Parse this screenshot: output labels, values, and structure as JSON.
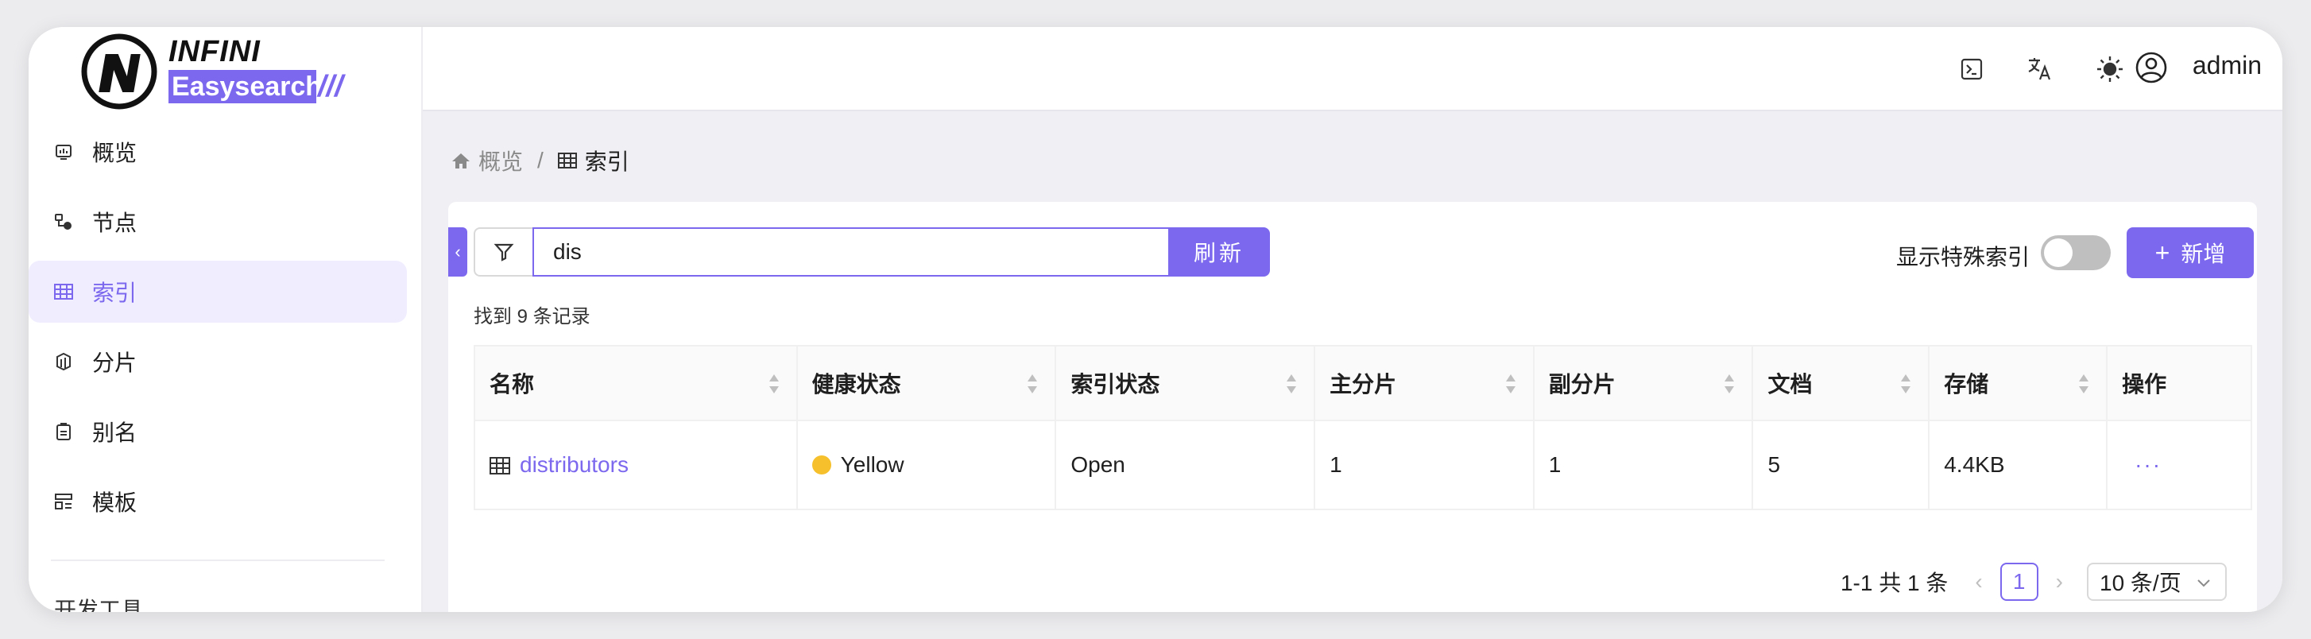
{
  "logo": {
    "top": "INFINI",
    "bottom": "Easysearch",
    "slashes": "///"
  },
  "sidebar": {
    "items": [
      {
        "label": "概览",
        "icon": "dashboard-icon",
        "active": false
      },
      {
        "label": "节点",
        "icon": "nodes-icon",
        "active": false
      },
      {
        "label": "索引",
        "icon": "table-icon",
        "active": true
      },
      {
        "label": "分片",
        "icon": "shards-icon",
        "active": false
      },
      {
        "label": "别名",
        "icon": "alias-icon",
        "active": false
      },
      {
        "label": "模板",
        "icon": "template-icon",
        "active": false
      }
    ],
    "partial_item": "开发工具"
  },
  "header": {
    "user": "admin"
  },
  "breadcrumb": {
    "home": "概览",
    "separator": "/",
    "current": "索引"
  },
  "toolbar": {
    "search_value": "dis",
    "refresh_label": "刷新",
    "special_index_label": "显示特殊索引",
    "special_index_on": false,
    "add_label": "新增"
  },
  "found_text": "找到 9 条记录",
  "table": {
    "columns": [
      "名称",
      "健康状态",
      "索引状态",
      "主分片",
      "副分片",
      "文档",
      "存储",
      "操作"
    ],
    "rows": [
      {
        "name": "distributors",
        "health": "Yellow",
        "status": "Open",
        "primary": "1",
        "replica": "1",
        "docs": "5",
        "storage": "4.4KB",
        "action": "···"
      }
    ]
  },
  "pagination": {
    "summary": "1-1 共 1 条",
    "current_page": "1",
    "page_size": "10 条/页"
  },
  "colors": {
    "accent": "#7b68ee",
    "health_yellow": "#f5c02b"
  }
}
